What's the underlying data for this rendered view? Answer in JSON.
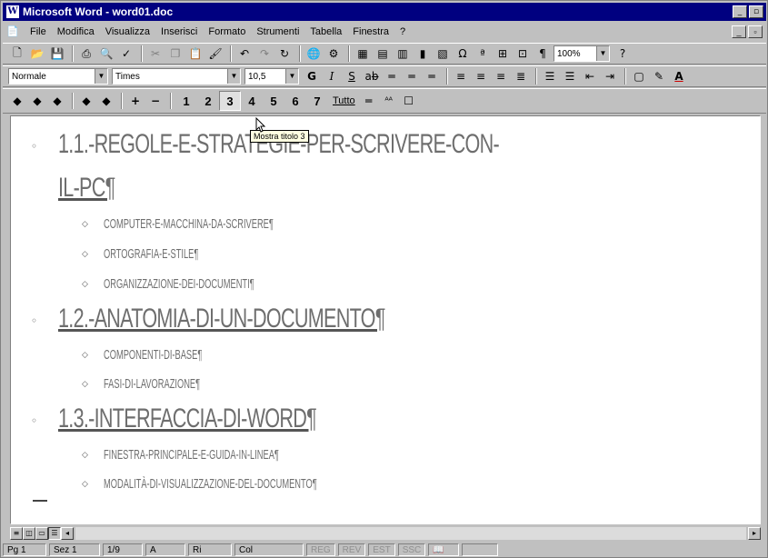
{
  "window": {
    "title": "Microsoft Word - word01.doc",
    "app_icon": "W"
  },
  "menu": [
    "File",
    "Modifica",
    "Visualizza",
    "Inserisci",
    "Formato",
    "Strumenti",
    "Tabella",
    "Finestra",
    "?"
  ],
  "toolbar_standard": {
    "zoom": "100%"
  },
  "toolbar_format": {
    "style": "Normale",
    "font": "Times",
    "size": "10,5",
    "bold": "G",
    "italic": "I",
    "underline": "S"
  },
  "toolbar_outline": {
    "levels": [
      "1",
      "2",
      "3",
      "4",
      "5",
      "6",
      "7"
    ],
    "tutto": "Tutto",
    "pressed_level": "3",
    "tooltip": "Mostra titolo 3"
  },
  "document": {
    "h1_a_line1": "1.1.-REGOLE-E-STRATEGIE-PER-SCRIVERE-CON-",
    "h1_a_line2": "IL-PC¶",
    "h2_a": [
      "COMPUTER-E-MACCHINA-DA-SCRIVERE¶",
      "ORTOGRAFIA-E-STILE¶",
      "ORGANIZZAZIONE-DEI-DOCUMENTI¶"
    ],
    "h1_b": "1.2.-ANATOMIA-DI-UN-DOCUMENTO¶",
    "h2_b": [
      "COMPONENTI-DI-BASE¶",
      "FASI-DI-LAVORAZIONE¶"
    ],
    "h1_c": "1.3.-INTERFACCIA-DI-WORD¶",
    "h2_c": [
      "FINESTRA-PRINCIPALE-E-GUIDA-IN-LINEA¶",
      "MODALITÀ-DI-VISUALIZZAZIONE-DEL-DOCUMENTO¶"
    ]
  },
  "statusbar": {
    "page": "Pg 1",
    "section": "Sez 1",
    "pages": "1/9",
    "at": "A",
    "line": "Ri",
    "col": "Col",
    "modes": [
      "REG",
      "REV",
      "EST",
      "SSC"
    ]
  }
}
